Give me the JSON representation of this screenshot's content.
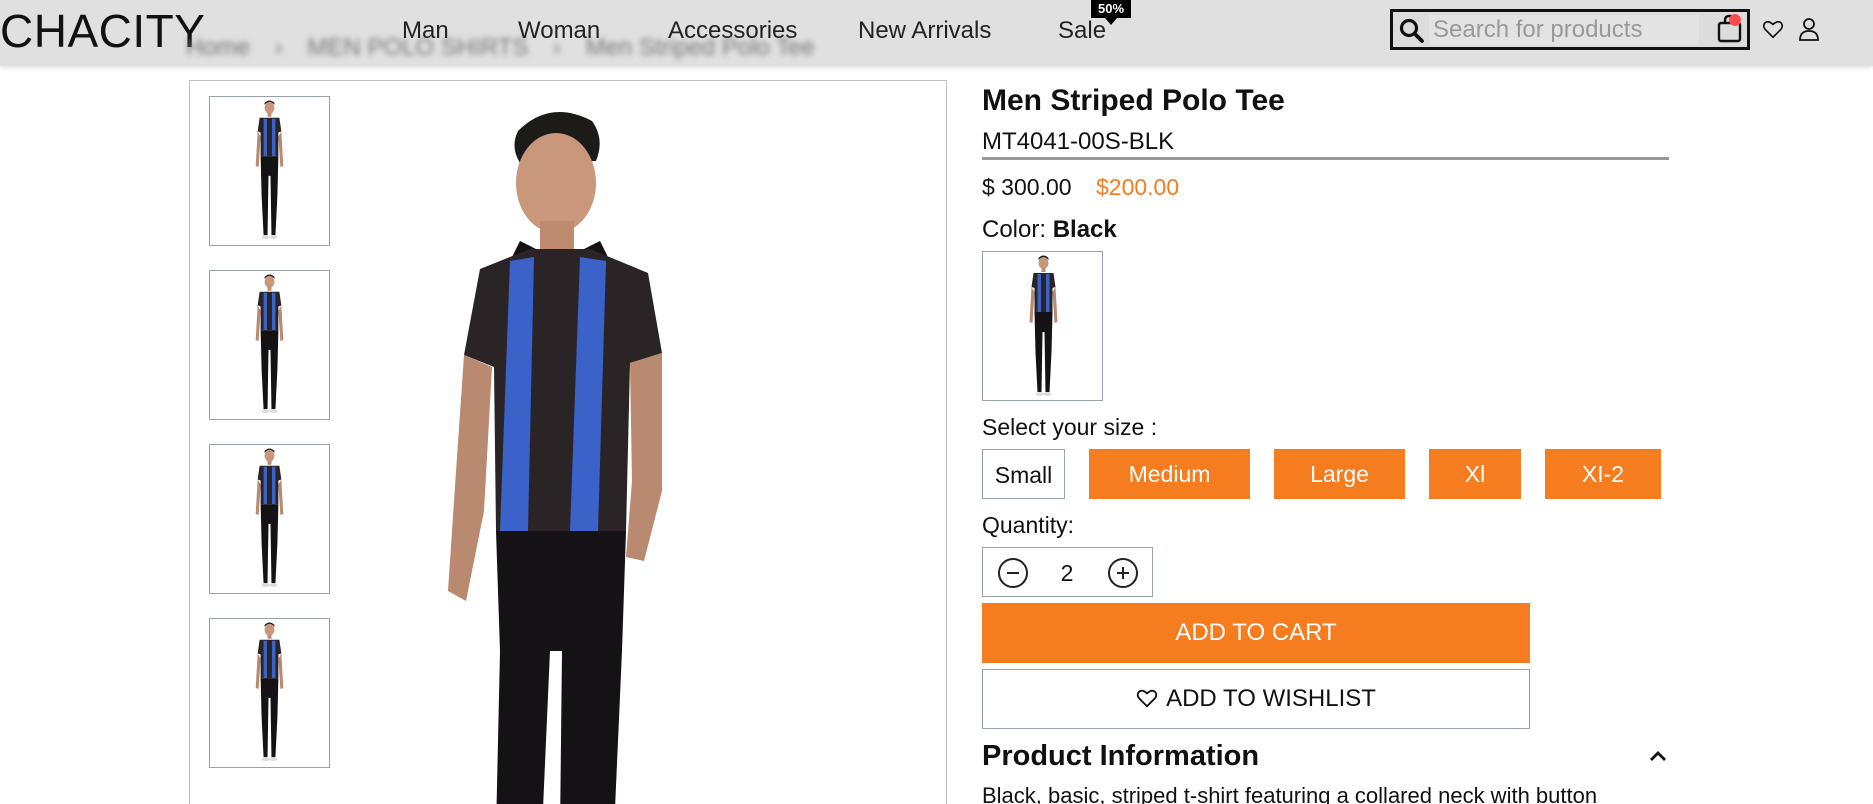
{
  "brand": {
    "name": "CHACITY"
  },
  "breadcrumb": [
    "Home",
    "MEN POLO SHIRTS",
    "Men Striped Polo Tee"
  ],
  "nav": {
    "items": [
      "Man",
      "Woman",
      "Accessories",
      "New Arrivals",
      "Sale"
    ],
    "sale_badge": "50%"
  },
  "search": {
    "placeholder": "Search for products",
    "value": ""
  },
  "header_icons": [
    "search-icon",
    "cart-icon",
    "heart-icon",
    "user-icon"
  ],
  "product": {
    "title": "Men Striped Polo Tee",
    "sku": "MT4041-00S-BLK",
    "price_original": "$ 300.00",
    "price_sale": "$200.00",
    "color_label": "Color:",
    "color_value": "Black",
    "size_label": "Select your size :",
    "sizes": [
      {
        "label": "Small",
        "available": false
      },
      {
        "label": "Medium",
        "available": true
      },
      {
        "label": "Large",
        "available": true
      },
      {
        "label": "Xl",
        "available": true
      },
      {
        "label": "XI-2",
        "available": true
      }
    ],
    "quantity_label": "Quantity:",
    "quantity": "2",
    "add_to_cart": "ADD TO CART",
    "add_to_wishlist": "ADD TO WISHLIST",
    "info_heading": "Product Information",
    "info_text": "Black, basic, striped t-shirt featuring a collared neck with button"
  },
  "colors": {
    "accent": "#f57c1f",
    "header_bg": "#e0e0e0",
    "shirt_black": "#2a2426",
    "stripe_blue": "#3a62c8"
  }
}
